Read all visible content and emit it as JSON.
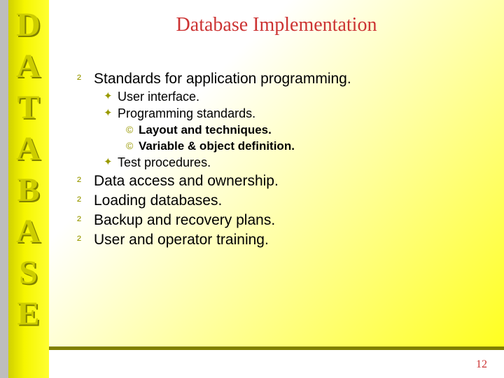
{
  "sidebar": {
    "letters": [
      "D",
      "A",
      "T",
      "A",
      "B",
      "A",
      "S",
      "E"
    ]
  },
  "slide": {
    "title": "Database Implementation",
    "page_number": "12",
    "bullets": [
      {
        "text": "Standards for application programming.",
        "children": [
          {
            "text": "User interface."
          },
          {
            "text": "Programming standards.",
            "children": [
              {
                "text": "Layout and techniques."
              },
              {
                "text": "Variable & object  definition."
              }
            ]
          },
          {
            "text": "Test procedures."
          }
        ]
      },
      {
        "text": "Data access and ownership."
      },
      {
        "text": "Loading databases."
      },
      {
        "text": "Backup and recovery plans."
      },
      {
        "text": "User and operator training."
      }
    ]
  },
  "glyphs": {
    "l1": "²",
    "l2": "✦",
    "l3": "©"
  }
}
